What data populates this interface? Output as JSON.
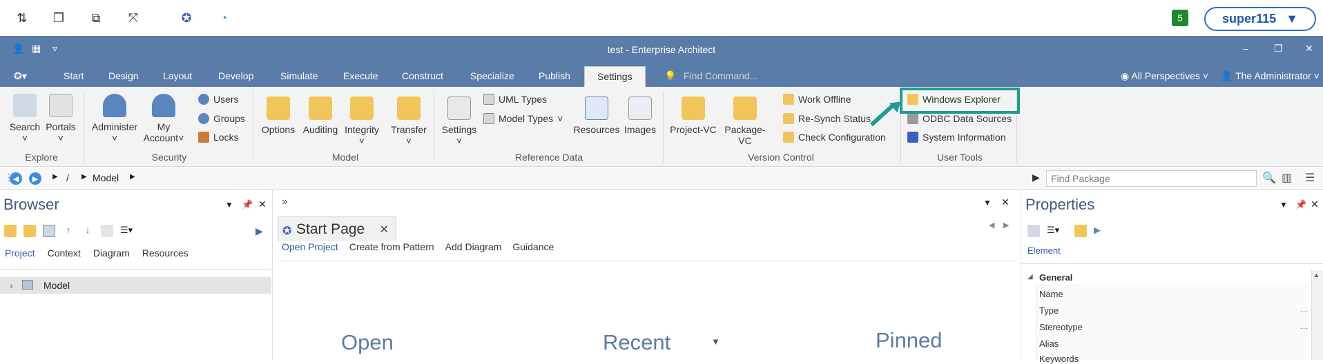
{
  "remote_bar": {
    "icons": [
      "arrows-updown-icon",
      "restore-window-icon",
      "duplicate-window-icon",
      "fullscreen-icon",
      "ea-disconnected-icon",
      "edge-disconnected-icon"
    ],
    "notification_count": "5",
    "user_name": "super115"
  },
  "window": {
    "title": "test - Enterprise Architect"
  },
  "tabs": {
    "items": [
      "Start",
      "Design",
      "Layout",
      "Develop",
      "Simulate",
      "Execute",
      "Construct",
      "Specialize",
      "Publish",
      "Settings"
    ],
    "active": "Settings",
    "find_command": "Find Command...",
    "perspectives": "All Perspectives",
    "user": "The Administrator"
  },
  "ribbon": {
    "explore": {
      "label": "Explore",
      "search": "Search",
      "portals": "Portals"
    },
    "security": {
      "label": "Security",
      "administer": "Administer",
      "my": "My",
      "account": "Account",
      "users": "Users",
      "groups": "Groups",
      "locks": "Locks"
    },
    "model": {
      "label": "Model",
      "options": "Options",
      "auditing": "Auditing",
      "integrity": "Integrity",
      "transfer": "Transfer"
    },
    "reference": {
      "label": "Reference Data",
      "settings": "Settings",
      "uml_types": "UML Types",
      "model_types": "Model Types",
      "resources": "Resources",
      "images": "Images"
    },
    "version": {
      "label": "Version Control",
      "project_vc": "Project-VC",
      "package_vc": "Package-VC",
      "work_offline": "Work Offline",
      "resynch": "Re-Synch Status",
      "check_config": "Check Configuration"
    },
    "user_tools": {
      "label": "User Tools",
      "windows_explorer": "Windows Explorer",
      "odbc": "ODBC Data Sources",
      "system_info": "System Information"
    }
  },
  "navbar": {
    "path_root": "/",
    "path_model": "Model",
    "find_package_placeholder": "Find Package"
  },
  "browser": {
    "title": "Browser",
    "tabs": [
      "Project",
      "Context",
      "Diagram",
      "Resources"
    ],
    "tree_item": "Model"
  },
  "start_page": {
    "tab_label": "Start Page",
    "links": [
      "Open Project",
      "Create from Pattern",
      "Add Diagram",
      "Guidance"
    ],
    "open": "Open",
    "recent": "Recent",
    "pinned": "Pinned"
  },
  "properties": {
    "title": "Properties",
    "tab": "Element",
    "group": "General",
    "fields": [
      "Name",
      "Type",
      "Stereotype",
      "Alias",
      "Keywords"
    ]
  },
  "colors": {
    "title_bar": "#5a7ca8",
    "highlight": "#1e9c91",
    "accent": "#2a5ea8"
  }
}
